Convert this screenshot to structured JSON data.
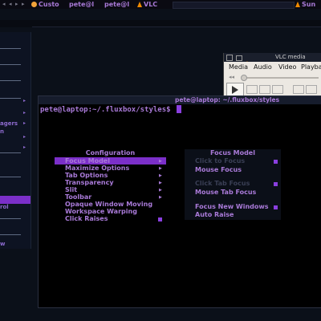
{
  "toolbar": {
    "pager_arrows": [
      "◂",
      "◂",
      "▸",
      "▸"
    ],
    "items": [
      "Custo",
      "pete@l",
      "pete@l",
      "VLC"
    ],
    "workspace": "Sun"
  },
  "left_menu": {
    "labels": [
      "agers",
      "n",
      "rol",
      "w"
    ]
  },
  "vlc": {
    "title": "VLC media",
    "menu": [
      "Media",
      "Audio",
      "Video",
      "Playba"
    ]
  },
  "terminal": {
    "title": "pete@laptop: ~/.fluxbox/styles",
    "prompt": "pete@laptop:~/.fluxbox/styles$ "
  },
  "config_menu": {
    "title": "Configuration",
    "items": [
      {
        "label": "Focus Model"
      },
      {
        "label": "Maximize Options"
      },
      {
        "label": "Tab Options"
      },
      {
        "label": "Transparency"
      },
      {
        "label": "Slit"
      },
      {
        "label": "Toolbar"
      },
      {
        "label": "Opaque Window Moving"
      },
      {
        "label": "Workspace Warping"
      },
      {
        "label": "Click Raises"
      }
    ]
  },
  "focus_menu": {
    "title": "Focus Model",
    "items": [
      {
        "label": "Click to Focus"
      },
      {
        "label": "Mouse Focus"
      },
      {
        "label": "Click Tab Focus"
      },
      {
        "label": "Mouse Tab Focus"
      },
      {
        "label": "Focus New Windows"
      },
      {
        "label": "Auto Raise"
      }
    ]
  },
  "colors": {
    "accent": "#a97ad8",
    "highlight": "#7b2fc9",
    "terminal_bg": "#000000",
    "disabled": "#3a3f55"
  }
}
